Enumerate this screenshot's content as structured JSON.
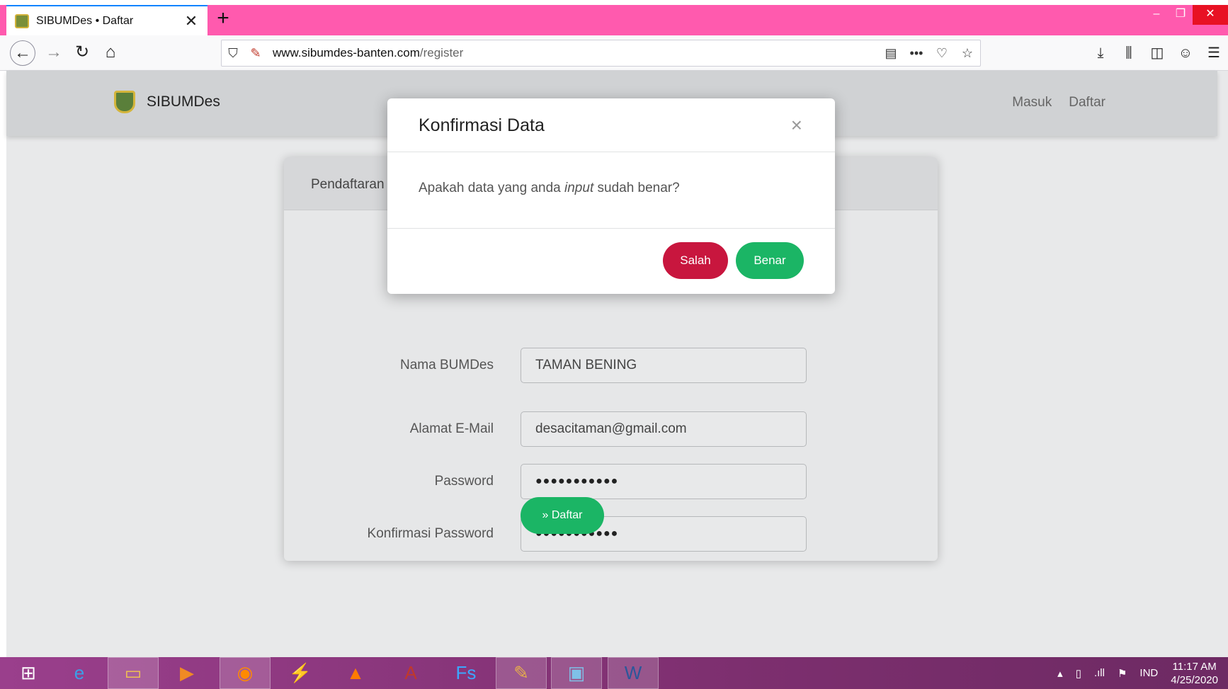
{
  "browser": {
    "tab_title": "SIBUMDes • Daftar",
    "url_domain": "www.sibumdes-banten.com",
    "url_path": "/register"
  },
  "site": {
    "brand": "SIBUMDes",
    "nav": [
      "Masuk",
      "Daftar"
    ]
  },
  "form": {
    "header": "Pendaftaran",
    "fields": [
      {
        "label": "Nama BUMDes",
        "value": "TAMAN BENING"
      },
      {
        "label": "Alamat E-Mail",
        "value": "desacitaman@gmail.com"
      },
      {
        "label": "Password",
        "value": "●●●●●●●●●●●"
      },
      {
        "label": "Konfirmasi Password",
        "value": "●●●●●●●●●●●"
      }
    ],
    "submit_label": "» Daftar"
  },
  "modal": {
    "title": "Konfirmasi Data",
    "close": "×",
    "body_before": "Apakah data yang anda ",
    "body_em": "input",
    "body_after": " sudah benar?",
    "btn_no": "Salah",
    "btn_yes": "Benar"
  },
  "taskbar": {
    "language": "IND",
    "time": "11:17 AM",
    "date": "4/25/2020"
  }
}
